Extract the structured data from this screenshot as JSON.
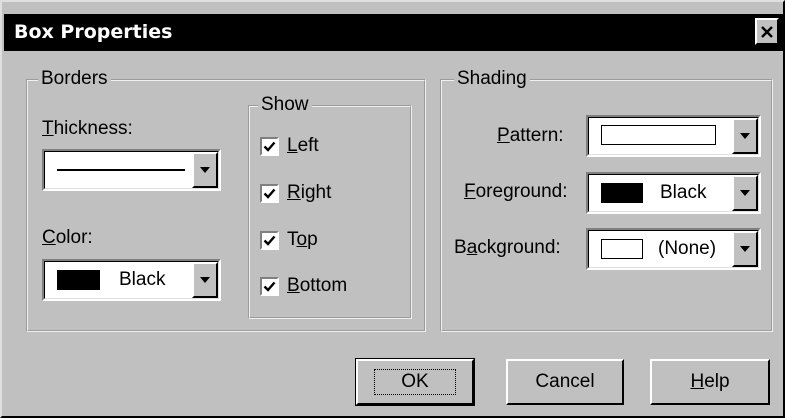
{
  "window": {
    "title": "Box Properties"
  },
  "borders": {
    "legend": "Borders",
    "thickness_label": "Thickness:",
    "color_label": "Color:",
    "color_value": "Black",
    "color_swatch": "#000000"
  },
  "show": {
    "legend": "Show",
    "items": [
      {
        "label": "Left",
        "checked": true
      },
      {
        "label": "Right",
        "checked": true
      },
      {
        "label": "Top",
        "checked": true
      },
      {
        "label": "Bottom",
        "checked": true
      }
    ]
  },
  "shading": {
    "legend": "Shading",
    "pattern_label": "Pattern:",
    "foreground_label": "Foreground:",
    "foreground_value": "Black",
    "foreground_swatch": "#000000",
    "background_label": "Background:",
    "background_value": "(None)",
    "background_swatch": "#ffffff"
  },
  "buttons": {
    "ok": "OK",
    "cancel": "Cancel",
    "help": "Help"
  },
  "icons": {
    "close": "close-icon",
    "dropdown": "chevron-down-icon",
    "check": "check-icon"
  }
}
